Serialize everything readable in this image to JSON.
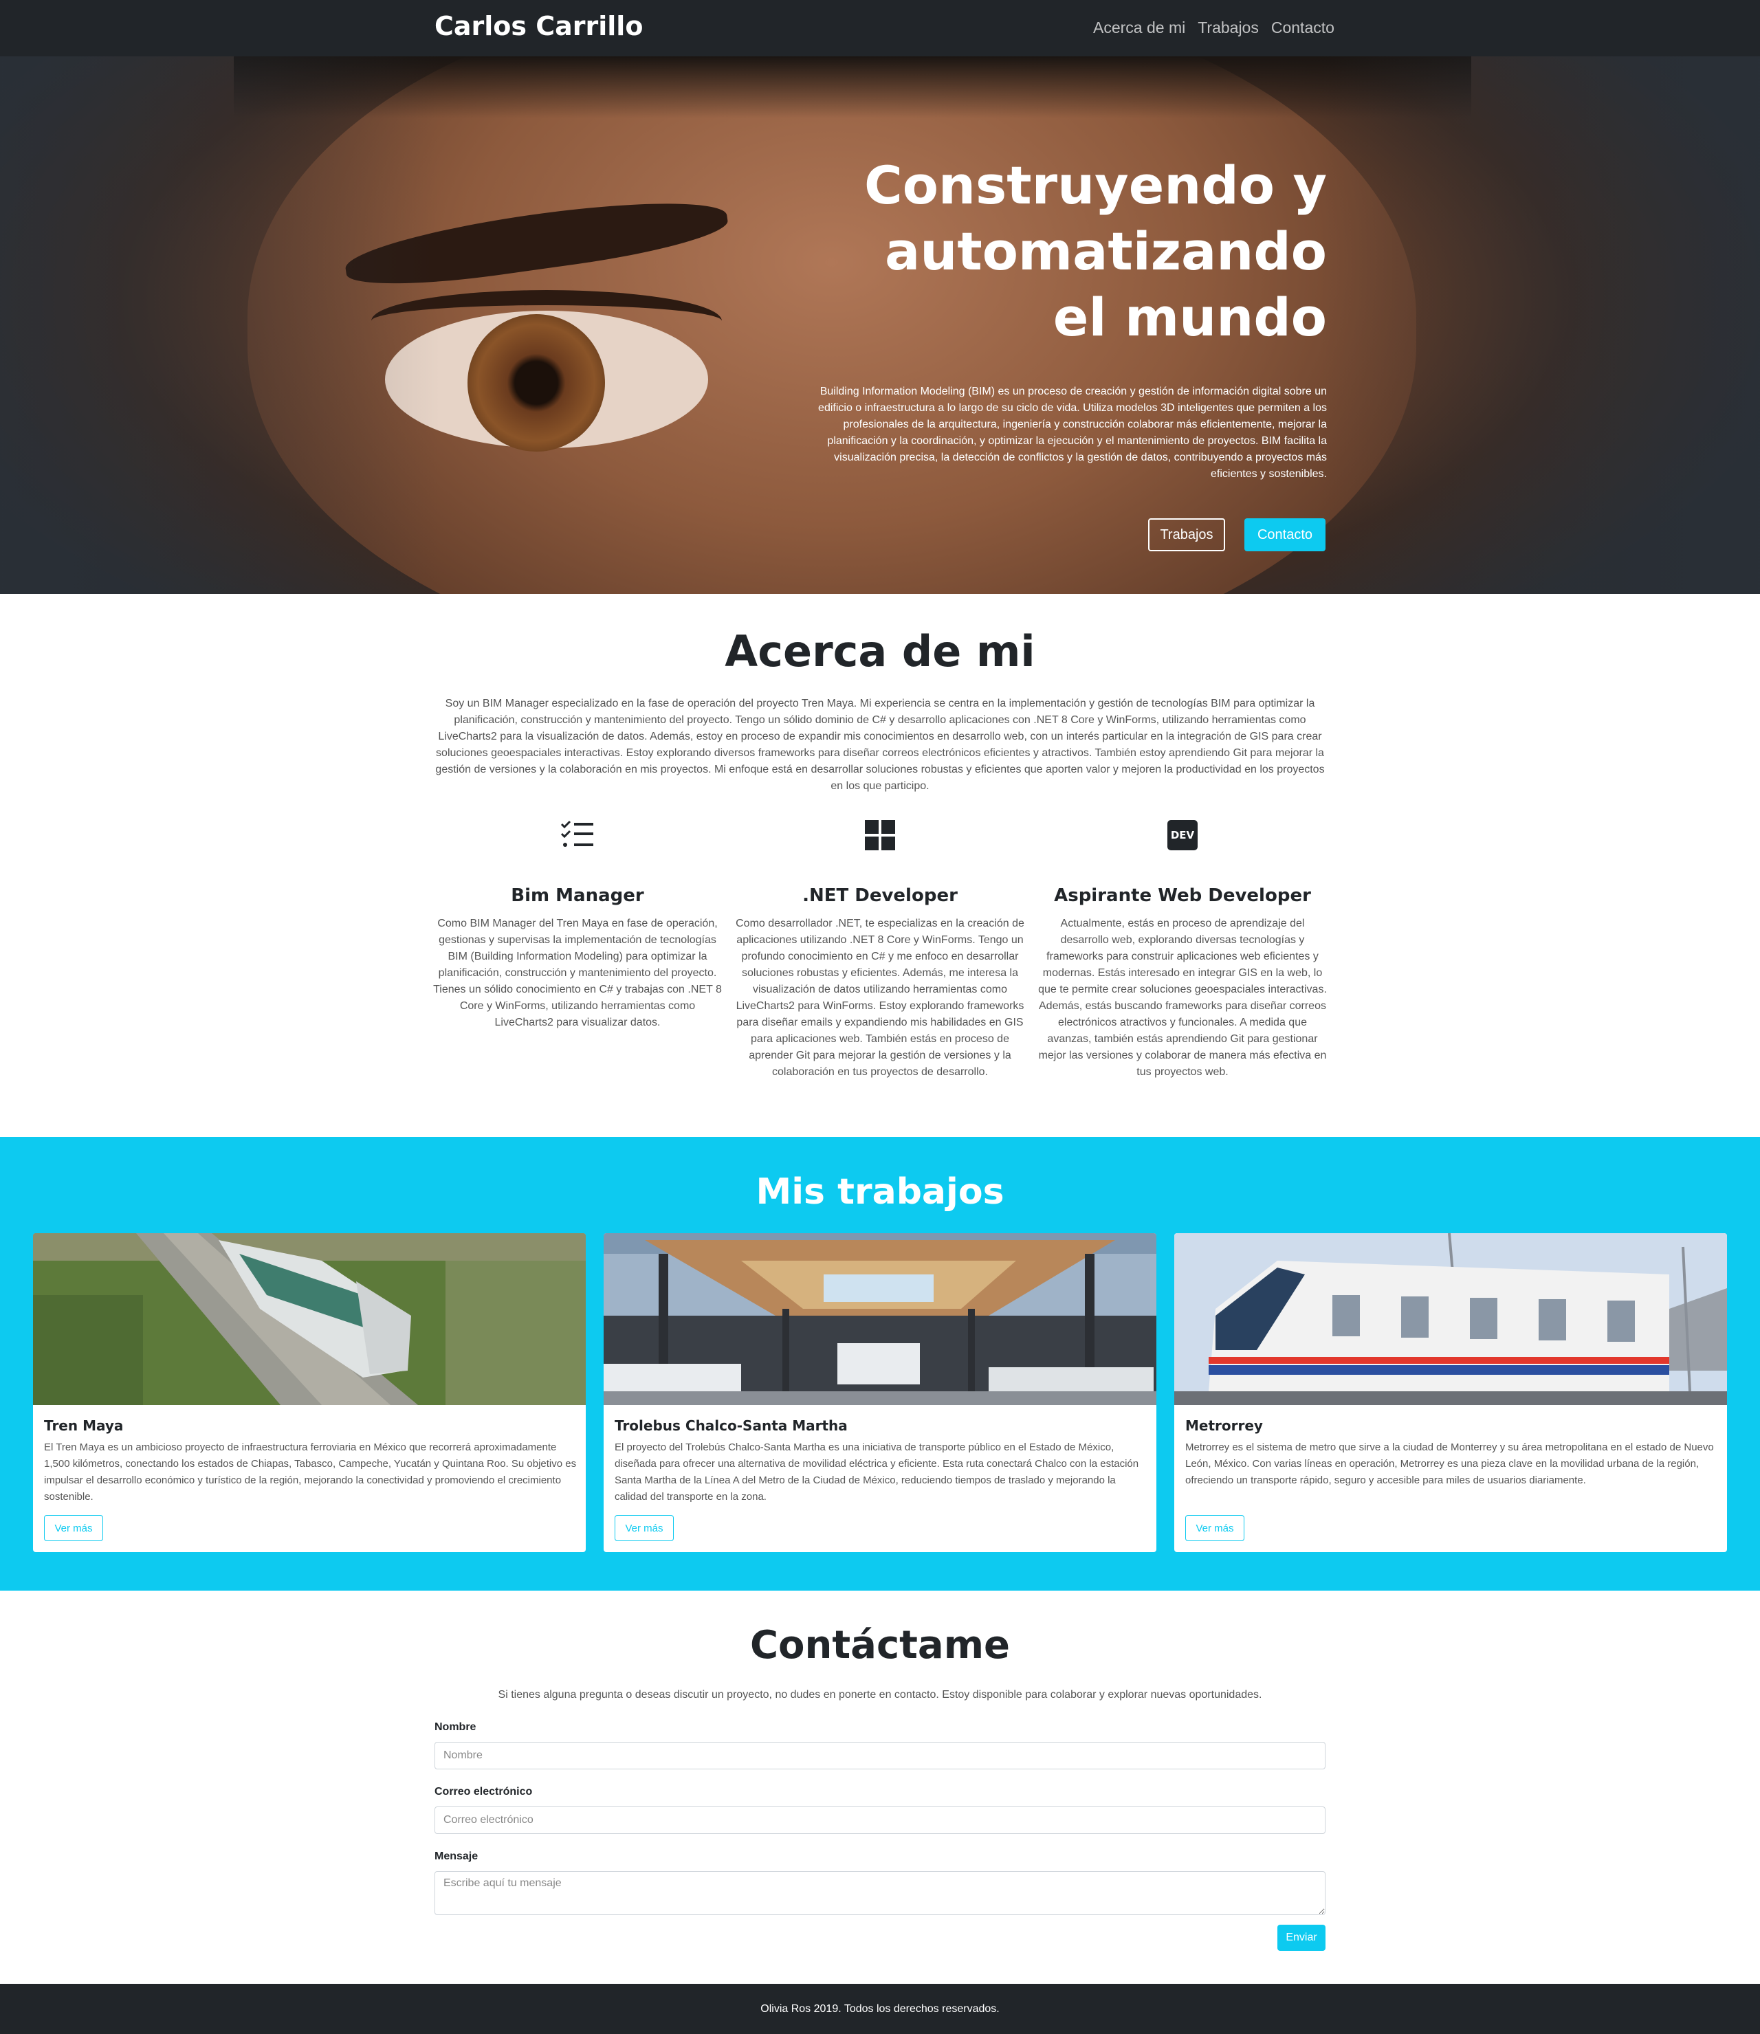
{
  "navbar": {
    "brand": "Carlos Carrillo",
    "links": [
      "Acerca de mi",
      "Trabajos",
      "Contacto"
    ]
  },
  "hero": {
    "title_line1": "Construyendo y",
    "title_line2": "automatizando",
    "title_line3": "el mundo",
    "text": "Building Information Modeling (BIM) es un proceso de creación y gestión de información digital sobre un edificio o infraestructura a lo largo de su ciclo de vida. Utiliza modelos 3D inteligentes que permiten a los profesionales de la arquitectura, ingeniería y construcción colaborar más eficientemente, mejorar la planificación y la coordinación, y optimizar la ejecución y el mantenimiento de proyectos. BIM facilita la visualización precisa, la detección de conflictos y la gestión de datos, contribuyendo a proyectos más eficientes y sostenibles.",
    "btn_works": "Trabajos",
    "btn_contact": "Contacto"
  },
  "about": {
    "title": "Acerca de mi",
    "text": "Soy un BIM Manager especializado en la fase de operación del proyecto Tren Maya. Mi experiencia se centra en la implementación y gestión de tecnologías BIM para optimizar la planificación, construcción y mantenimiento del proyecto. Tengo un sólido dominio de C# y desarrollo aplicaciones con .NET 8 Core y WinForms, utilizando herramientas como LiveCharts2 para la visualización de datos. Además, estoy en proceso de expandir mis conocimientos en desarrollo web, con un interés particular en la integración de GIS para crear soluciones geoespaciales interactivas. Estoy explorando diversos frameworks para diseñar correos electrónicos eficientes y atractivos. También estoy aprendiendo Git para mejorar la gestión de versiones y la colaboración en mis proyectos. Mi enfoque está en desarrollar soluciones robustas y eficientes que aporten valor y mejoren la productividad en los proyectos en los que participo.",
    "features": [
      {
        "icon": "checklist-icon",
        "title": "Bim Manager",
        "text": "Como BIM Manager del Tren Maya en fase de operación, gestionas y supervisas la implementación de tecnologías BIM (Building Information Modeling) para optimizar la planificación, construcción y mantenimiento del proyecto. Tienes un sólido conocimiento en C# y trabajas con .NET 8 Core y WinForms, utilizando herramientas como LiveCharts2 para visualizar datos."
      },
      {
        "icon": "windows-icon",
        "title": ".NET Developer",
        "text": "Como desarrollador .NET, te especializas en la creación de aplicaciones utilizando .NET 8 Core y WinForms. Tengo un profundo conocimiento en C# y me enfoco en desarrollar soluciones robustas y eficientes. Además, me interesa la visualización de datos utilizando herramientas como LiveCharts2 para WinForms. Estoy explorando frameworks para diseñar emails y expandiendo mis habilidades en GIS para aplicaciones web. También estás en proceso de aprender Git para mejorar la gestión de versiones y la colaboración en tus proyectos de desarrollo."
      },
      {
        "icon": "dev-icon",
        "title": "Aspirante Web Developer",
        "text": "Actualmente, estás en proceso de aprendizaje del desarrollo web, explorando diversas tecnologías y frameworks para construir aplicaciones web eficientes y modernas. Estás interesado en integrar GIS en la web, lo que te permite crear soluciones geoespaciales interactivas. Además, estás buscando frameworks para diseñar correos electrónicos atractivos y funcionales. A medida que avanzas, también estás aprendiendo Git para gestionar mejor las versiones y colaborar de manera más efectiva en tus proyectos web."
      }
    ],
    "dev_icon_text": "DEV"
  },
  "works": {
    "title": "Mis trabajos",
    "cards": [
      {
        "title": "Tren Maya",
        "text": "El Tren Maya es un ambicioso proyecto de infraestructura ferroviaria en México que recorrerá aproximadamente 1,500 kilómetros, conectando los estados de Chiapas, Tabasco, Campeche, Yucatán y Quintana Roo. Su objetivo es impulsar el desarrollo económico y turístico de la región, mejorando la conectividad y promoviendo el crecimiento sostenible.",
        "button": "Ver más"
      },
      {
        "title": "Trolebus Chalco-Santa Martha",
        "text": "El proyecto del Trolebús Chalco-Santa Martha es una iniciativa de transporte público en el Estado de México, diseñada para ofrecer una alternativa de movilidad eléctrica y eficiente. Esta ruta conectará Chalco con la estación Santa Martha de la Línea A del Metro de la Ciudad de México, reduciendo tiempos de traslado y mejorando la calidad del transporte en la zona.",
        "button": "Ver más"
      },
      {
        "title": "Metrorrey",
        "text": "Metrorrey es el sistema de metro que sirve a la ciudad de Monterrey y su área metropolitana en el estado de Nuevo León, México. Con varias líneas en operación, Metrorrey es una pieza clave en la movilidad urbana de la región, ofreciendo un transporte rápido, seguro y accesible para miles de usuarios diariamente.",
        "button": "Ver más"
      }
    ]
  },
  "contact": {
    "title": "Contáctame",
    "text": "Si tienes alguna pregunta o deseas discutir un proyecto, no dudes en ponerte en contacto. Estoy disponible para colaborar y explorar nuevas oportunidades.",
    "name_label": "Nombre",
    "name_placeholder": "Nombre",
    "email_label": "Correo electrónico",
    "email_placeholder": "Correo electrónico",
    "message_label": "Mensaje",
    "message_placeholder": "Escribe aquí tu mensaje",
    "submit": "Enviar"
  },
  "footer": {
    "text": "Olivia Ros 2019. Todos los derechos reservados."
  },
  "colors": {
    "accent": "#0dcaf0",
    "dark": "#212529"
  }
}
